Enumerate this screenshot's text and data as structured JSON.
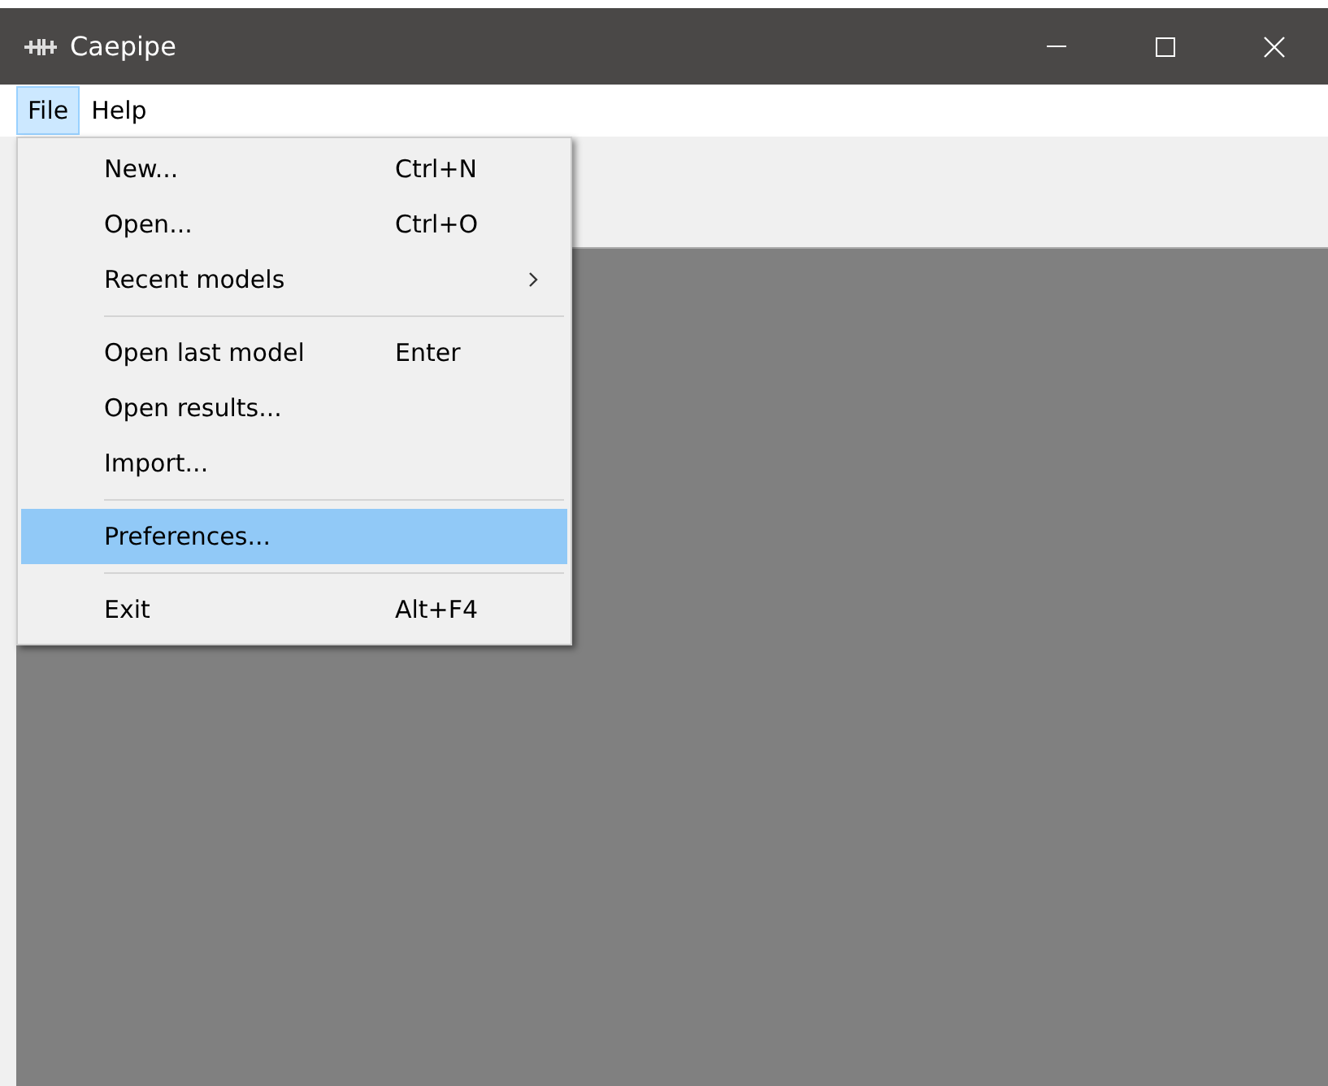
{
  "window": {
    "title": "Caepipe"
  },
  "menubar": [
    {
      "label": "File",
      "selected": true
    },
    {
      "label": "Help",
      "selected": false
    }
  ],
  "file_menu": [
    {
      "kind": "item",
      "label": "New...",
      "shortcut": "Ctrl+N",
      "submenu": false,
      "selected": false
    },
    {
      "kind": "item",
      "label": "Open...",
      "shortcut": "Ctrl+O",
      "submenu": false,
      "selected": false
    },
    {
      "kind": "item",
      "label": "Recent models",
      "submenu": true,
      "selected": false
    },
    {
      "kind": "separator"
    },
    {
      "kind": "item",
      "label": "Open last model",
      "shortcut": "Enter",
      "submenu": false,
      "selected": false
    },
    {
      "kind": "item",
      "label": "Open results...",
      "submenu": false,
      "selected": false
    },
    {
      "kind": "item",
      "label": "Import...",
      "submenu": false,
      "selected": false
    },
    {
      "kind": "separator"
    },
    {
      "kind": "item",
      "label": "Preferences...",
      "submenu": false,
      "selected": true
    },
    {
      "kind": "separator"
    },
    {
      "kind": "item",
      "label": "Exit",
      "shortcut": "Alt+F4",
      "submenu": false,
      "selected": false
    }
  ]
}
